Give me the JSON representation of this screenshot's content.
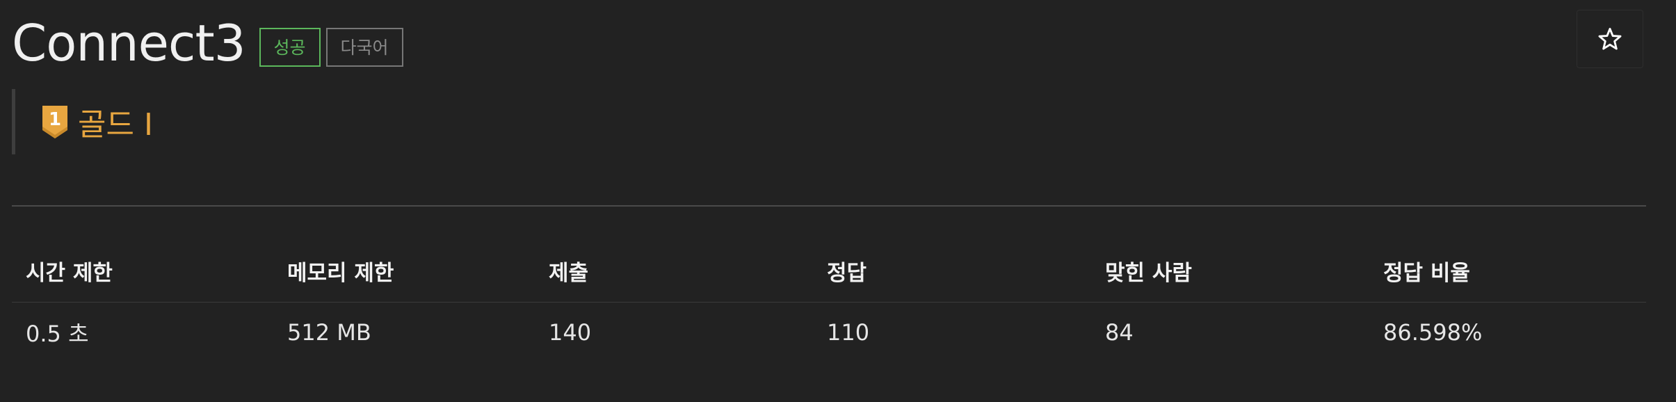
{
  "problem": {
    "title": "Connect3",
    "badges": {
      "success": "성공",
      "multilang": "다국어"
    },
    "tier": {
      "icon": "gold-tier-1-icon",
      "badge_number": "1",
      "label": "골드 I",
      "color": "#e8a640"
    },
    "star_icon": "star-outline-icon"
  },
  "stats": {
    "headers": [
      "시간 제한",
      "메모리 제한",
      "제출",
      "정답",
      "맞힌 사람",
      "정답 비율"
    ],
    "values": [
      "0.5 초",
      "512 MB",
      "140",
      "110",
      "84",
      "86.598%"
    ]
  },
  "colors": {
    "background": "#222222",
    "success": "#5cb85c",
    "tier_gold": "#e8a640"
  }
}
